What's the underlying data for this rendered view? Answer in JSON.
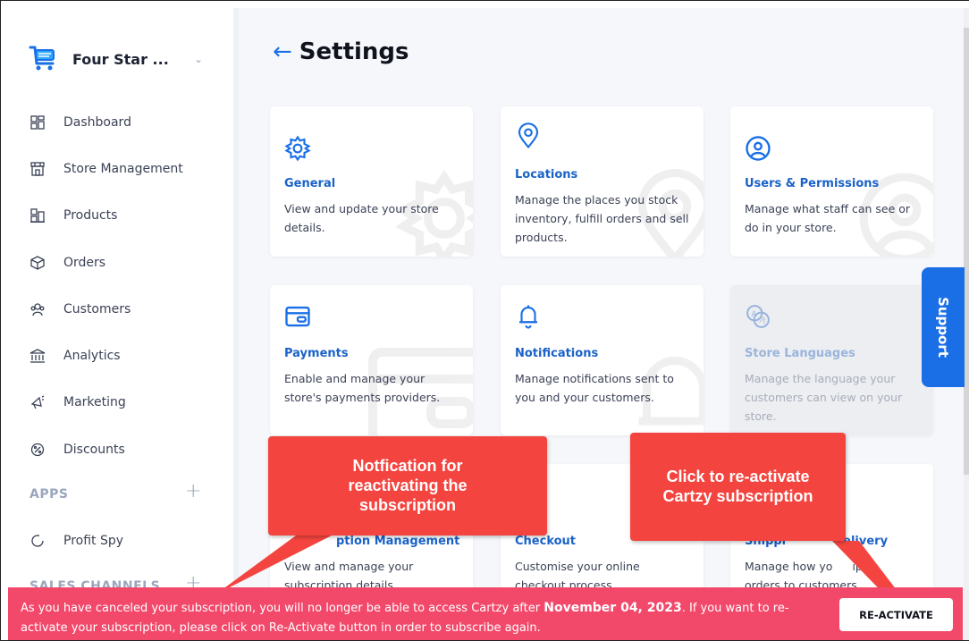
{
  "brand": {
    "name": "Four Star ..."
  },
  "sidebar": {
    "items": [
      {
        "label": "Dashboard",
        "icon": "dashboard-icon"
      },
      {
        "label": "Store Management",
        "icon": "store-icon"
      },
      {
        "label": "Products",
        "icon": "products-icon"
      },
      {
        "label": "Orders",
        "icon": "orders-icon"
      },
      {
        "label": "Customers",
        "icon": "customers-icon"
      },
      {
        "label": "Analytics",
        "icon": "analytics-icon"
      },
      {
        "label": "Marketing",
        "icon": "megaphone-icon"
      },
      {
        "label": "Discounts",
        "icon": "discount-icon"
      }
    ],
    "apps_label": "APPS",
    "apps": [
      {
        "label": "Profit Spy",
        "icon": "profit-spy-icon"
      }
    ],
    "sales_channels_label": "SALES CHANNELS"
  },
  "page": {
    "title": "Settings"
  },
  "cards": [
    {
      "title": "General",
      "desc": "View and update your store details.",
      "icon": "gear-icon"
    },
    {
      "title": "Locations",
      "desc": "Manage the places you stock inventory, fulfill orders and sell products.",
      "icon": "location-pin-icon"
    },
    {
      "title": "Users & Permissions",
      "desc": "Manage what staff can see or do in your store.",
      "icon": "user-circle-icon"
    },
    {
      "title": "Payments",
      "desc": "Enable and manage your store's payments providers.",
      "icon": "credit-card-icon"
    },
    {
      "title": "Notifications",
      "desc": "Manage notifications sent to you and your customers.",
      "icon": "bell-icon"
    },
    {
      "title": "Store Languages",
      "desc": "Manage the language your customers can view on your store.",
      "icon": "translate-icon"
    },
    {
      "title": "ption Management",
      "desc": "View and manage your subscription details",
      "icon": "subscription-icon"
    },
    {
      "title": "Checkout",
      "desc": "Customise your online checkout process.",
      "icon": "checkout-icon"
    },
    {
      "title": "Shippi",
      "title_tail": "elivery",
      "desc": "Manage how yo",
      "desc_tail": "ip",
      "desc2": "orders to customers",
      "icon": "shipping-icon"
    }
  ],
  "support": {
    "label": "Support"
  },
  "callouts": {
    "left": [
      "Notfication for",
      "reactivating the",
      "subscription"
    ],
    "right": [
      "Click to re-activate",
      "Cartzy subscription"
    ]
  },
  "banner": {
    "text_before": "As you have canceled your subscription, you will no longer be able to access Cartzy after ",
    "date": "November 04, 2023",
    "text_after": ". If you want to re-activate your subscription, please click on Re-Activate button in order to subscribe again.",
    "button_label": "RE-ACTIVATE"
  },
  "colors": {
    "accent": "#1a6fe6",
    "banner": "#f2496b",
    "callout": "#f4443f",
    "link_title": "#1a62c8"
  }
}
